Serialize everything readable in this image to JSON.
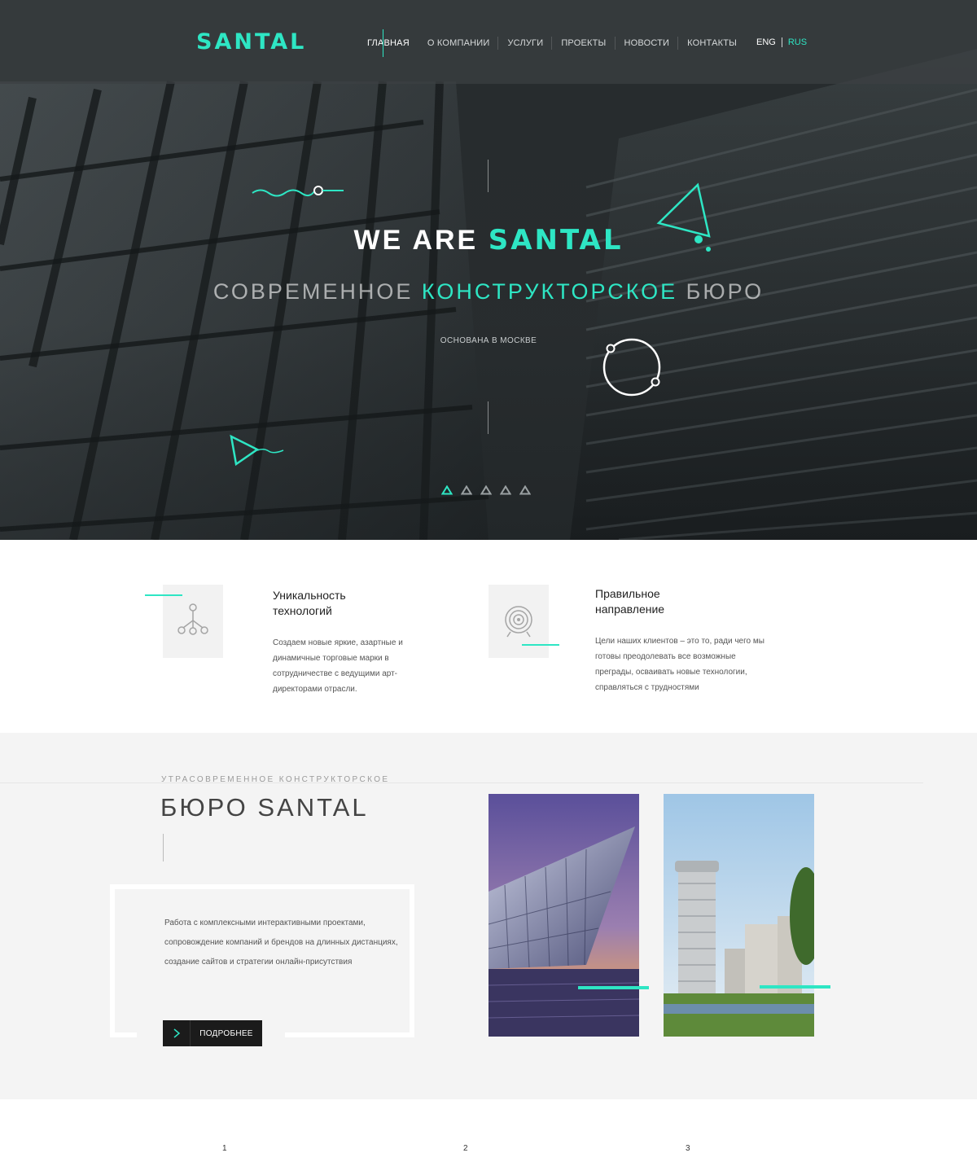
{
  "header": {
    "logo": "SANTAL",
    "nav": [
      {
        "label": "ГЛАВНАЯ",
        "active": true
      },
      {
        "label": "О КОМПАНИИ",
        "active": false
      },
      {
        "label": "УСЛУГИ",
        "active": false
      },
      {
        "label": "ПРОЕКТЫ",
        "active": false
      },
      {
        "label": "НОВОСТИ",
        "active": false
      },
      {
        "label": "КОНТАКТЫ",
        "active": false
      }
    ],
    "lang": {
      "eng": "ENG",
      "rus": "RUS",
      "active": "RUS"
    }
  },
  "hero": {
    "title_prefix": "WE ARE",
    "title_accent": "SANTAL",
    "subtitle_before": "СОВРЕМЕННОЕ",
    "subtitle_accent": "КОНСТРУКТОРСКОЕ",
    "subtitle_after": "БЮРО",
    "note": "ОСНОВАНА В МОСКВЕ",
    "slides_total": 5,
    "slide_active": 1
  },
  "features": [
    {
      "icon": "network-nodes-icon",
      "title_line1": "Уникальность",
      "title_line2": "технологий",
      "text": "Создаем новые яркие, азартные и динамичные торговые марки в сотрудничестве с ведущими арт-директорами отрасли."
    },
    {
      "icon": "target-icon",
      "title_line1": "Правильное",
      "title_line2": "направление",
      "text": "Цели наших клиентов – это то, ради чего мы готовы преодолевать все возможные преграды, осваивать новые технологии, справляться с трудностями"
    }
  ],
  "about": {
    "kicker": "УТРАСОВРЕМЕННОЕ КОНСТРУКТОРСКОЕ",
    "title": "БЮРО SANTAL",
    "text": "Работа с комплексными интерактивными проектами, сопровождение компаний и брендов на длинных дистанциях, создание сайтов и стратегии онлайн-присутствия",
    "button": "ПОДРОБНЕЕ"
  },
  "numbers": [
    "1",
    "2",
    "3"
  ],
  "colors": {
    "accent": "#2ee6c4",
    "dark": "#1b1b1b",
    "light_bg": "#f4f4f4"
  }
}
